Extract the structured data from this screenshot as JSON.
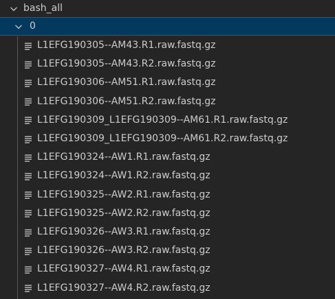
{
  "tree": {
    "root": {
      "label": "bash_all",
      "expanded": true,
      "icon": "chevron-down-icon"
    },
    "folder": {
      "label": "0",
      "expanded": true,
      "selected": true,
      "icon": "chevron-down-icon"
    },
    "files": [
      {
        "label": "L1EFG190305--AM43.R1.raw.fastq.gz",
        "icon": "file-lines-icon"
      },
      {
        "label": "L1EFG190305--AM43.R2.raw.fastq.gz",
        "icon": "file-lines-icon"
      },
      {
        "label": "L1EFG190306--AM51.R1.raw.fastq.gz",
        "icon": "file-lines-icon"
      },
      {
        "label": "L1EFG190306--AM51.R2.raw.fastq.gz",
        "icon": "file-lines-icon"
      },
      {
        "label": "L1EFG190309_L1EFG190309--AM61.R1.raw.fastq.gz",
        "icon": "file-lines-icon"
      },
      {
        "label": "L1EFG190309_L1EFG190309--AM61.R2.raw.fastq.gz",
        "icon": "file-lines-icon"
      },
      {
        "label": "L1EFG190324--AW1.R1.raw.fastq.gz",
        "icon": "file-lines-icon"
      },
      {
        "label": "L1EFG190324--AW1.R2.raw.fastq.gz",
        "icon": "file-lines-icon"
      },
      {
        "label": "L1EFG190325--AW2.R1.raw.fastq.gz",
        "icon": "file-lines-icon"
      },
      {
        "label": "L1EFG190325--AW2.R2.raw.fastq.gz",
        "icon": "file-lines-icon"
      },
      {
        "label": "L1EFG190326--AW3.R1.raw.fastq.gz",
        "icon": "file-lines-icon"
      },
      {
        "label": "L1EFG190326--AW3.R2.raw.fastq.gz",
        "icon": "file-lines-icon"
      },
      {
        "label": "L1EFG190327--AW4.R1.raw.fastq.gz",
        "icon": "file-lines-icon"
      },
      {
        "label": "L1EFG190327--AW4.R2.raw.fastq.gz",
        "icon": "file-lines-icon"
      }
    ]
  },
  "colors": {
    "background": "#252526",
    "selection_background": "#04395e",
    "selection_border": "#0e639c",
    "text": "#cccccc",
    "indent_guide": "#585858"
  }
}
